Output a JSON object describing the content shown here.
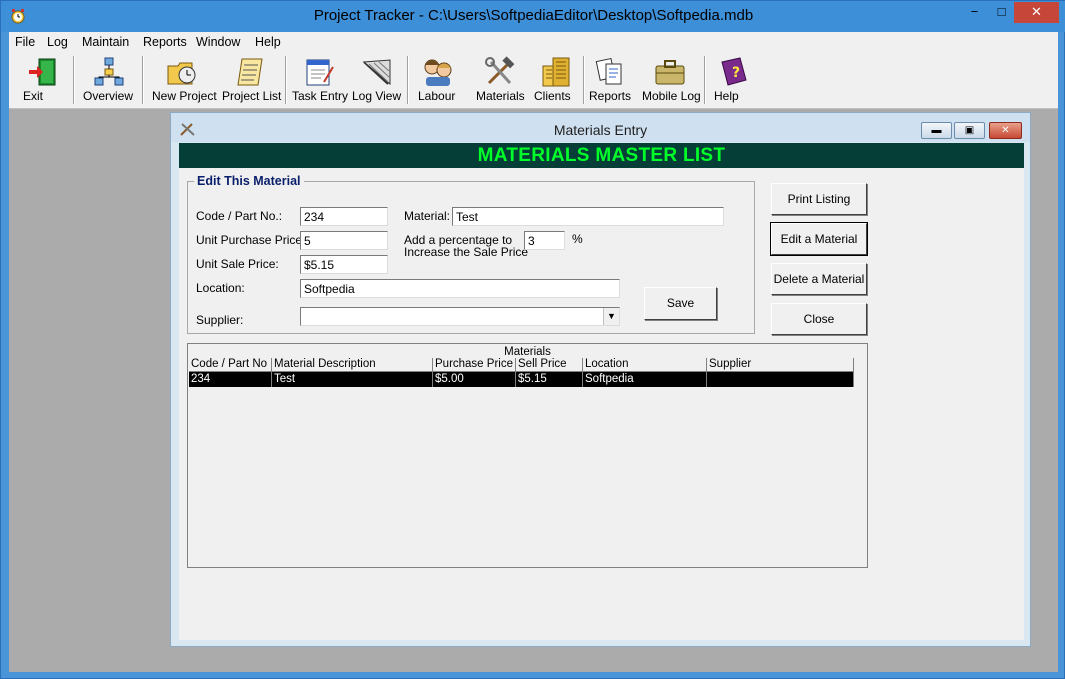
{
  "app": {
    "title": "Project Tracker - C:\\Users\\SoftpediaEditor\\Desktop\\Softpedia.mdb",
    "window_controls": {
      "minimize": "−",
      "maximize": "□",
      "close": "✕"
    }
  },
  "menu": [
    "File",
    "Log",
    "Maintain",
    "Reports",
    "Window",
    "Help"
  ],
  "toolbar": [
    {
      "label": "Exit",
      "icon": "exit-door-icon"
    },
    {
      "label": "Overview",
      "icon": "overview-tree-icon"
    },
    {
      "label": "New Project",
      "icon": "new-project-folder-icon"
    },
    {
      "label": "Project List",
      "icon": "project-list-scroll-icon"
    },
    {
      "label": "Task Entry",
      "icon": "task-entry-notepad-icon"
    },
    {
      "label": "Log View",
      "icon": "log-view-icon"
    },
    {
      "label": "Labour",
      "icon": "labour-people-icon"
    },
    {
      "label": "Materials",
      "icon": "materials-tools-icon"
    },
    {
      "label": "Clients",
      "icon": "clients-building-icon"
    },
    {
      "label": "Reports",
      "icon": "reports-documents-icon"
    },
    {
      "label": "Mobile Log",
      "icon": "mobile-log-briefcase-icon"
    },
    {
      "label": "Help",
      "icon": "help-book-icon"
    }
  ],
  "child_window": {
    "title": "Materials Entry",
    "banner": "MATERIALS MASTER LIST",
    "window_controls": {
      "minimize": "▬",
      "maximize": "▣",
      "close": "✕"
    }
  },
  "form": {
    "group_title": "Edit This Material",
    "code_label": "Code / Part No.:",
    "code_value": "234",
    "material_label": "Material:",
    "material_value": "Test",
    "unit_purchase_label": "Unit Purchase Price:",
    "unit_purchase_value": "5",
    "percentage_label_line1": "Add a percentage to",
    "percentage_label_line2": "Increase the Sale Price",
    "percentage_value": "3",
    "percent_sign": "%",
    "unit_sale_label": "Unit Sale Price:",
    "unit_sale_value": "$5.15",
    "location_label": "Location:",
    "location_value": "Softpedia",
    "supplier_label": "Supplier:",
    "supplier_value": "",
    "save_button": "Save"
  },
  "actions": {
    "print_listing": "Print Listing",
    "edit_material": "Edit a Material",
    "delete_material": "Delete a Material",
    "close": "Close"
  },
  "materials_grid": {
    "caption": "Materials",
    "columns": [
      "Code / Part No",
      "Material Description",
      "Purchase Price",
      "Sell Price",
      "Location",
      "Supplier"
    ],
    "rows": [
      [
        "234",
        "Test",
        "$5.00",
        "$5.15",
        "Softpedia",
        ""
      ]
    ]
  }
}
